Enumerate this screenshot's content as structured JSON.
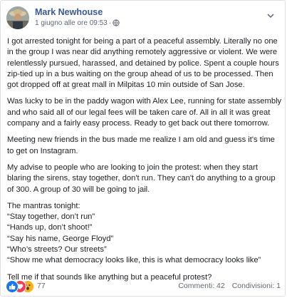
{
  "post": {
    "author": "Mark Newhouse",
    "timestamp": "1 giugno alle ore 09:53",
    "separator": "·",
    "privacy_icon": "globe-icon",
    "menu_icon": "chevron-down-icon",
    "paragraphs": [
      "I got arrested tonight for being a part of a peaceful assembly. Literally no one in the group I was near did anything remotely aggressive or violent. We were relentlessly pursued, harassed, and detained by police. Spent a couple hours zip-tied up in a bus waiting on the group ahead of us to be processed. Then got dropped off at great mall in Milpitas 10 min outside of San Jose.",
      "Was lucky to be in the paddy wagon with Alex Lee, running for state assembly and who said all of our legal fees will be taken care of. All in all it was great company and a fairly easy process. Ready to get back out there tomorrow.",
      "Meeting new friends in the bus made me realize I am old and guess it's time to get on Instagram.",
      "My advise to people who are looking to join the protest: when they start blaring the sirens, stay together, don't run. They can't do anything to a group of 300. A group of 30 will be going to jail."
    ],
    "mantras_title": "The mantras tonight:",
    "mantras": [
      "“Stay together, don’t run”",
      "“Hands up, don’t shoot!”",
      "“Say his name, George Floyd”",
      "“Who’s streets? Our streets”",
      "“Show me what democracy looks like, this is what democracy looks like”"
    ],
    "closing": "Tell me if that sounds like anything but a peaceful protest?"
  },
  "footer": {
    "reaction_icons": [
      "like-icon",
      "love-icon",
      "wow-icon"
    ],
    "reaction_count": "77",
    "comments": "Commenti: 42",
    "shares": "Condivisioni: 1"
  },
  "colors": {
    "author": "#385898",
    "meta": "#616770",
    "like": "#1877f2",
    "love": "#f33e58",
    "wow": "#f7b125"
  }
}
